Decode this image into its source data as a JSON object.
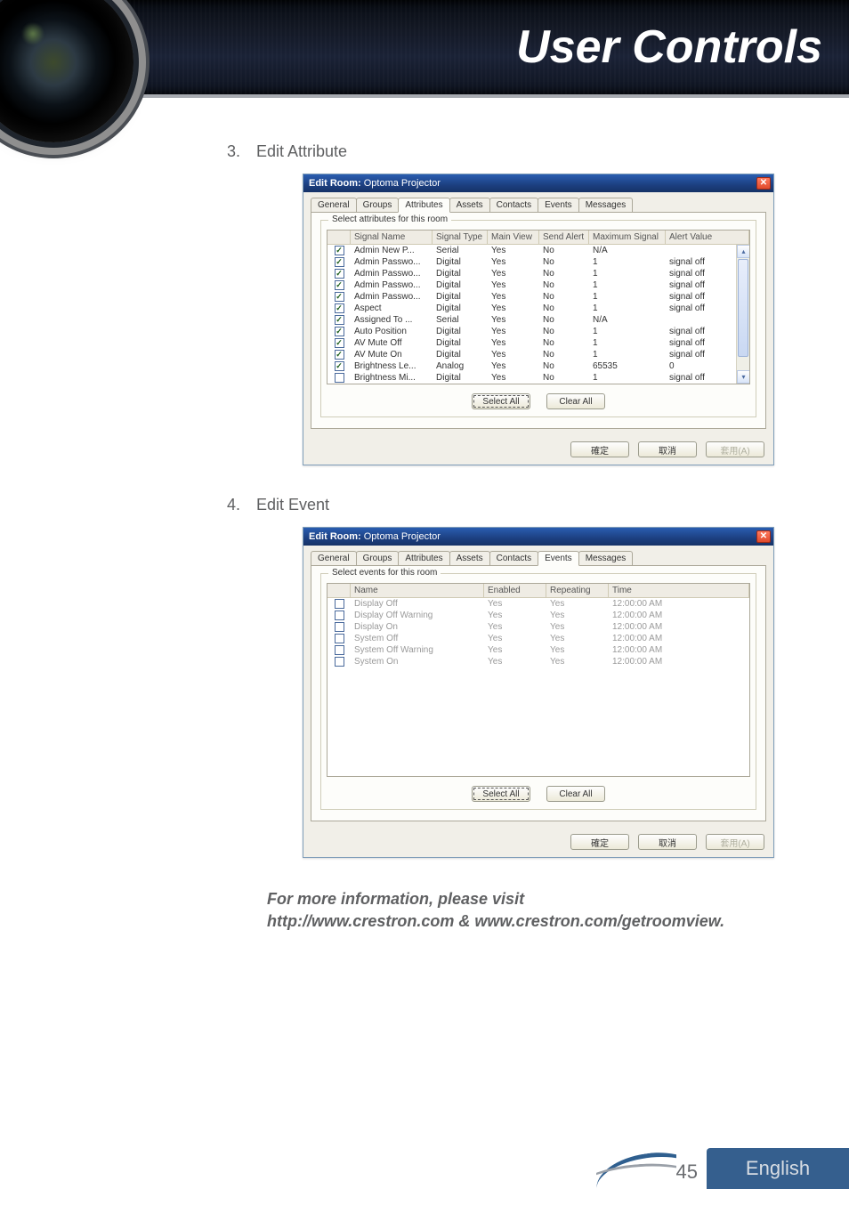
{
  "header": {
    "title": "User Controls"
  },
  "steps": [
    {
      "num": "3.",
      "label": "Edit Attribute"
    },
    {
      "num": "4.",
      "label": "Edit Event"
    }
  ],
  "dialog_title_prefix": "Edit Room: ",
  "dialog_room_name": "Optoma Projector",
  "tabs_all": [
    "General",
    "Groups",
    "Attributes",
    "Assets",
    "Contacts",
    "Events",
    "Messages"
  ],
  "attributes_dialog": {
    "active_tab": "Attributes",
    "group_label": "Select attributes for this room",
    "columns": [
      "Signal Name",
      "Signal Type",
      "Main View",
      "Send Alert",
      "Maximum Signal",
      "Alert Value"
    ],
    "rows": [
      {
        "checked": true,
        "name": "Admin New P...",
        "type": "Serial",
        "main": "Yes",
        "alert": "No",
        "max": "N/A",
        "val": ""
      },
      {
        "checked": true,
        "name": "Admin Passwo...",
        "type": "Digital",
        "main": "Yes",
        "alert": "No",
        "max": "1",
        "val": "signal off"
      },
      {
        "checked": true,
        "name": "Admin Passwo...",
        "type": "Digital",
        "main": "Yes",
        "alert": "No",
        "max": "1",
        "val": "signal off"
      },
      {
        "checked": true,
        "name": "Admin Passwo...",
        "type": "Digital",
        "main": "Yes",
        "alert": "No",
        "max": "1",
        "val": "signal off"
      },
      {
        "checked": true,
        "name": "Admin Passwo...",
        "type": "Digital",
        "main": "Yes",
        "alert": "No",
        "max": "1",
        "val": "signal off"
      },
      {
        "checked": true,
        "name": "Aspect",
        "type": "Digital",
        "main": "Yes",
        "alert": "No",
        "max": "1",
        "val": "signal off"
      },
      {
        "checked": true,
        "name": "Assigned To ...",
        "type": "Serial",
        "main": "Yes",
        "alert": "No",
        "max": "N/A",
        "val": ""
      },
      {
        "checked": true,
        "name": "Auto Position",
        "type": "Digital",
        "main": "Yes",
        "alert": "No",
        "max": "1",
        "val": "signal off"
      },
      {
        "checked": true,
        "name": "AV Mute Off",
        "type": "Digital",
        "main": "Yes",
        "alert": "No",
        "max": "1",
        "val": "signal off"
      },
      {
        "checked": true,
        "name": "AV Mute On",
        "type": "Digital",
        "main": "Yes",
        "alert": "No",
        "max": "1",
        "val": "signal off"
      },
      {
        "checked": true,
        "name": "Brightness Le...",
        "type": "Analog",
        "main": "Yes",
        "alert": "No",
        "max": "65535",
        "val": "0"
      },
      {
        "checked": false,
        "name": "Brightness Mi...",
        "type": "Digital",
        "main": "Yes",
        "alert": "No",
        "max": "1",
        "val": "signal off"
      }
    ],
    "buttons": {
      "select_all": "Select All",
      "clear_all": "Clear All"
    }
  },
  "events_dialog": {
    "active_tab": "Events",
    "group_label": "Select events for this room",
    "columns": [
      "Name",
      "Enabled",
      "Repeating",
      "Time"
    ],
    "rows": [
      {
        "checked": false,
        "name": "Display Off",
        "enabled": "Yes",
        "repeating": "Yes",
        "time": "12:00:00 AM"
      },
      {
        "checked": false,
        "name": "Display Off Warning",
        "enabled": "Yes",
        "repeating": "Yes",
        "time": "12:00:00 AM"
      },
      {
        "checked": false,
        "name": "Display On",
        "enabled": "Yes",
        "repeating": "Yes",
        "time": "12:00:00 AM"
      },
      {
        "checked": false,
        "name": "System Off",
        "enabled": "Yes",
        "repeating": "Yes",
        "time": "12:00:00 AM"
      },
      {
        "checked": false,
        "name": "System Off Warning",
        "enabled": "Yes",
        "repeating": "Yes",
        "time": "12:00:00 AM"
      },
      {
        "checked": false,
        "name": "System On",
        "enabled": "Yes",
        "repeating": "Yes",
        "time": "12:00:00 AM"
      }
    ],
    "buttons": {
      "select_all": "Select All",
      "clear_all": "Clear All"
    }
  },
  "dialog_buttons": {
    "ok": "確定",
    "cancel": "取消",
    "apply": "套用(A)"
  },
  "info_note_line1": "For more information, please visit",
  "info_note_line2": "http://www.crestron.com & www.crestron.com/getroomview.",
  "footer": {
    "page": "45",
    "lang": "English"
  }
}
